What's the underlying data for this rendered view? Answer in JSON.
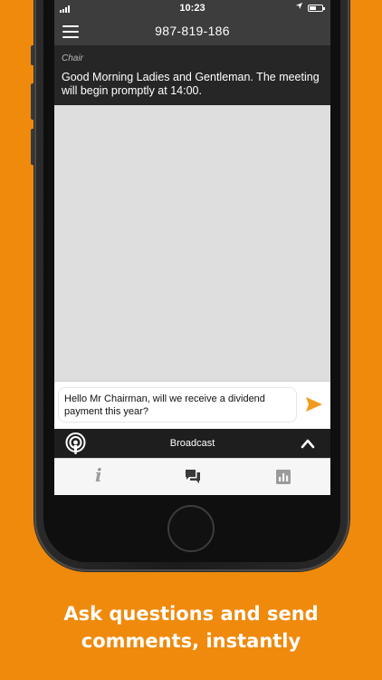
{
  "status_bar": {
    "time": "10:23",
    "signal_icon": "signal-bars-icon",
    "location_icon": "location-arrow-icon",
    "battery_icon": "battery-icon",
    "battery_level": 0.55
  },
  "header": {
    "title": "987-819-186",
    "menu_icon": "hamburger-menu-icon"
  },
  "message": {
    "sender": "Chair",
    "text": "Good Morning Ladies and Gentleman. The meeting will begin promptly at 14:00."
  },
  "compose": {
    "value": "Hello Mr Chairman, will we receive a dividend payment this year?",
    "send_icon": "send-arrow-icon"
  },
  "broadcast": {
    "icon": "broadcast-podcast-icon",
    "label": "Broadcast",
    "toggle_icon": "chevron-up-icon"
  },
  "tabs": [
    {
      "icon": "info-icon",
      "glyph": "i",
      "active": false
    },
    {
      "icon": "chat-bubbles-icon",
      "active": true
    },
    {
      "icon": "bar-chart-icon",
      "active": false
    }
  ],
  "tagline": {
    "line1": "Ask questions and send",
    "line2": "comments, instantly"
  },
  "colors": {
    "background": "#ef8a0c",
    "accent": "#f39a1d",
    "header": "#3d3d3d",
    "message_panel": "#262626",
    "broadcast_bar": "#1e1e1e"
  }
}
